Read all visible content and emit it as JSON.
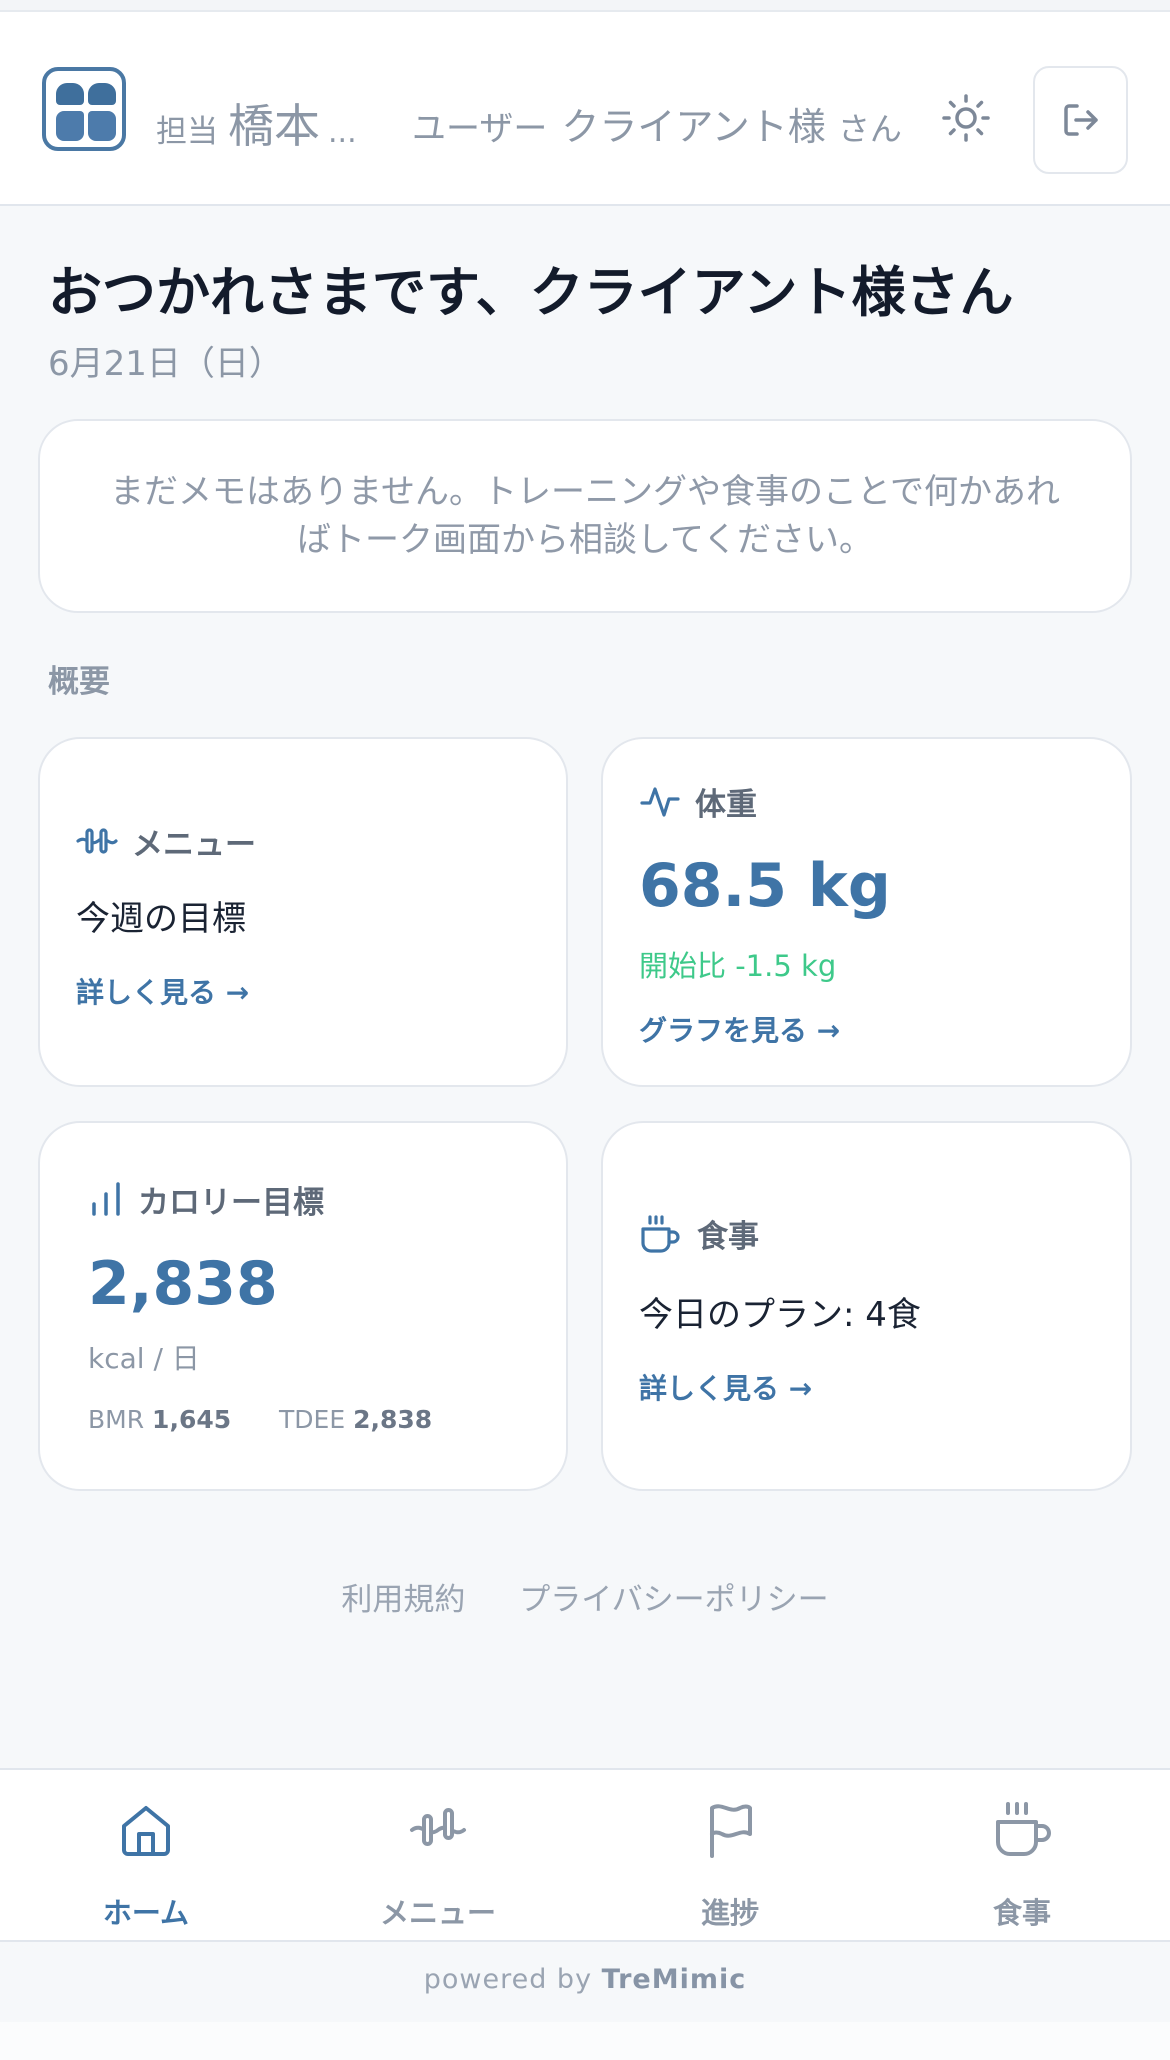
{
  "header": {
    "trainer_label": "担当",
    "trainer_name": "橋本",
    "trainer_ellipsis": "...",
    "user_label": "ユーザー",
    "user_name": "クライアント様",
    "user_suffix": "さん"
  },
  "greeting": "おつかれさまです、クライアント様さん",
  "date": "6月21日（日）",
  "memo_text": "まだメモはありません。トレーニングや食事のことで何かあればトーク画面から相談してください。",
  "overview_title": "概要",
  "cards": {
    "menu": {
      "title": "メニュー",
      "body": "今週の目標",
      "link": "詳しく見る →"
    },
    "weight": {
      "title": "体重",
      "value": "68.5 kg",
      "diff": "開始比 -1.5 kg",
      "link": "グラフを見る →"
    },
    "calorie": {
      "title": "カロリー目標",
      "value": "2,838",
      "unit": "kcal / 日",
      "bmr_label": "BMR",
      "bmr_value": "1,645",
      "tdee_label": "TDEE",
      "tdee_value": "2,838"
    },
    "meal": {
      "title": "食事",
      "body": "今日のプラン: 4食",
      "link": "詳しく見る →"
    }
  },
  "footer": {
    "terms": "利用規約",
    "privacy": "プライバシーポリシー"
  },
  "nav": [
    {
      "label": "ホーム",
      "icon": "home-icon",
      "active": true
    },
    {
      "label": "メニュー",
      "icon": "dumbbell-icon",
      "active": false
    },
    {
      "label": "進捗",
      "icon": "flag-icon",
      "active": false
    },
    {
      "label": "食事",
      "icon": "coffee-cup-icon",
      "active": false
    }
  ],
  "powered": {
    "prefix": "powered by",
    "brand": "TreMimic"
  },
  "colors": {
    "accent": "#3f74a6",
    "positive": "#3ec98a",
    "muted": "#8c97a6"
  }
}
